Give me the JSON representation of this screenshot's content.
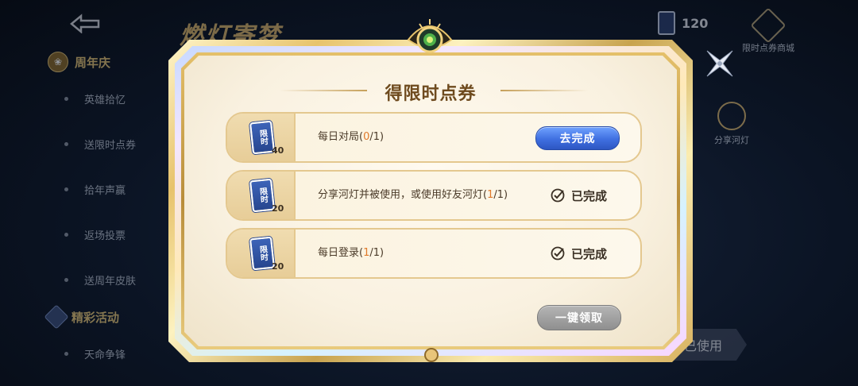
{
  "background": {
    "title_logo": "燃灯寄梦",
    "coins": "120",
    "shop_label": "限时点券商城",
    "share_label": "分享河灯",
    "used_button": "已使用",
    "sidebar": {
      "section1": "周年庆",
      "items": [
        "英雄拾忆",
        "送限时点券",
        "拾年声赢",
        "返场投票",
        "送周年皮肤"
      ],
      "section2": "精彩活动",
      "item_last": "天命争锋"
    }
  },
  "modal": {
    "title": "得限时点券",
    "ticket_glyph": "限时",
    "tasks": [
      {
        "reward": "40",
        "text": "每日对局(",
        "progress": "0",
        "total": "/1)",
        "action_label": "去完成",
        "status": "pending"
      },
      {
        "reward": "20",
        "text": "分享河灯并被使用，或使用好友河灯(",
        "progress": "1",
        "total": "/1)",
        "action_label": "已完成",
        "status": "done"
      },
      {
        "reward": "20",
        "text": "每日登录(",
        "progress": "1",
        "total": "/1)",
        "action_label": "已完成",
        "status": "done"
      }
    ],
    "claim_all_label": "一键领取"
  },
  "icons": {
    "close": "close-x-icon",
    "back": "back-arrow-icon",
    "check": "check-circle-icon",
    "ticket": "ticket-icon"
  },
  "colors": {
    "accent_blue": "#3f6fe0",
    "title_brown": "#6e4a1e",
    "progress_orange": "#e07a2a",
    "gold": "#e4c06a"
  }
}
